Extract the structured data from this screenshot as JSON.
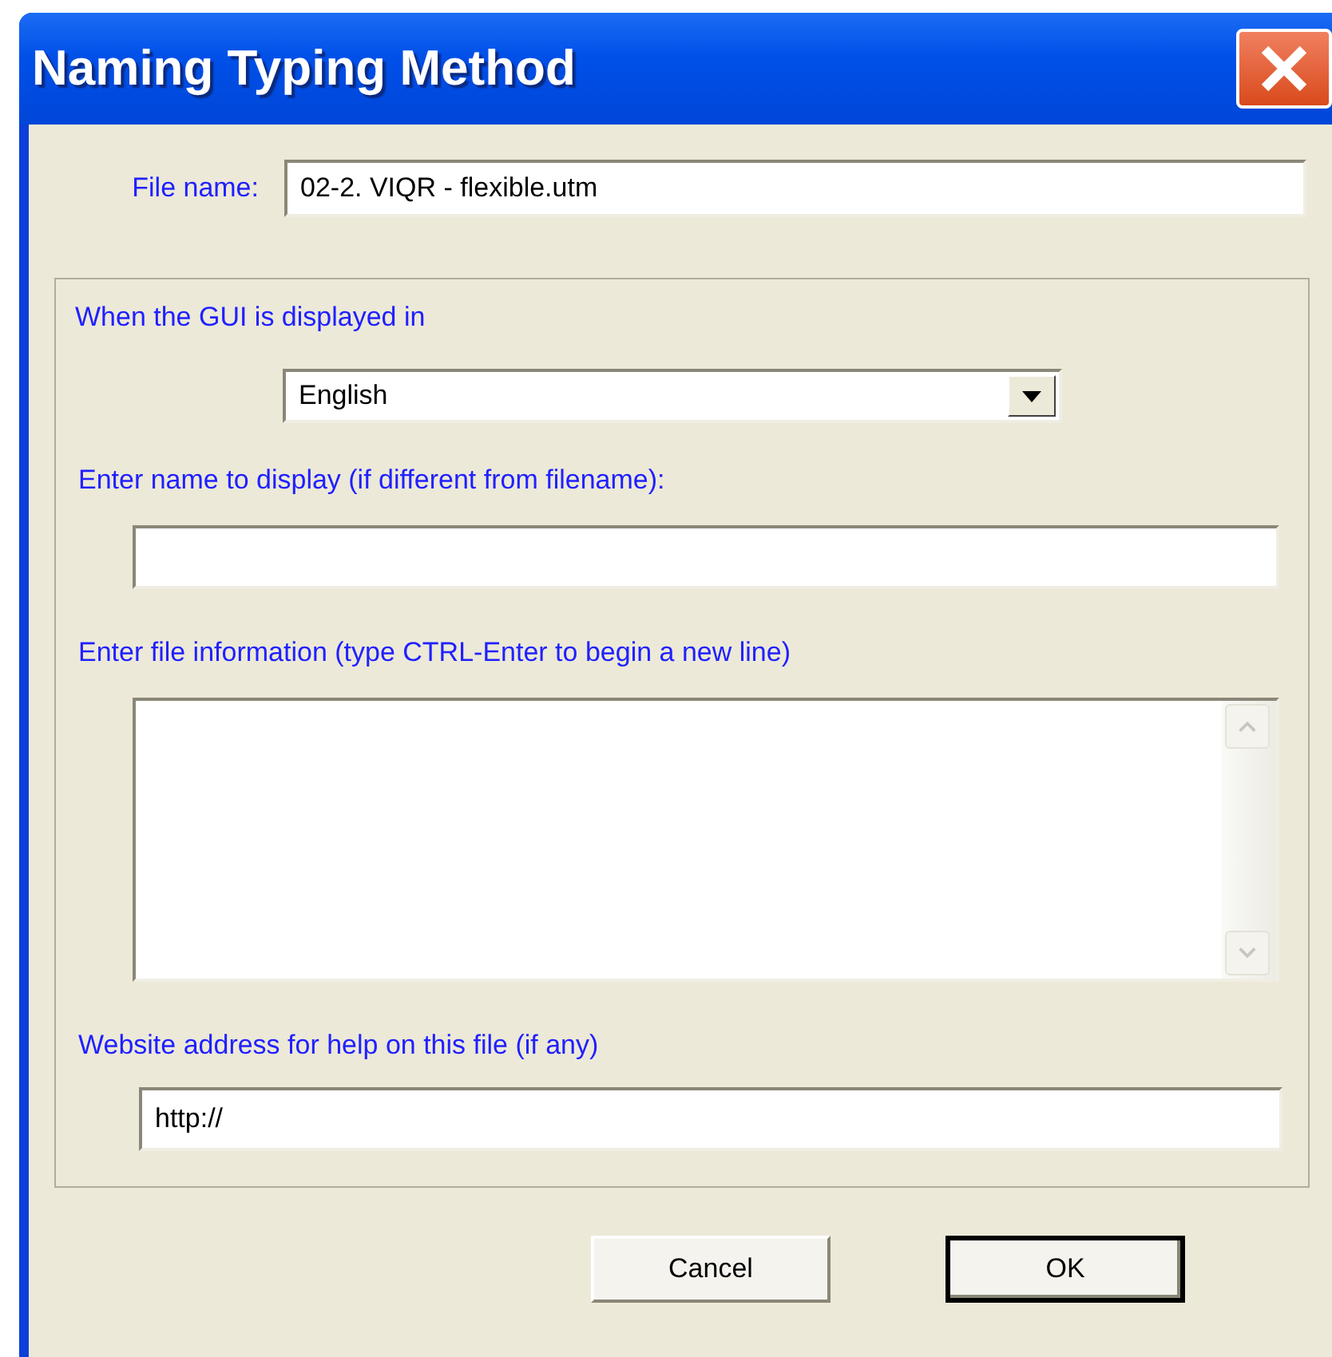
{
  "window": {
    "title": "Naming Typing Method"
  },
  "file_name": {
    "label": "File name:",
    "value": "02-2. VIQR - flexible.utm"
  },
  "group": {
    "language_label": "When the GUI is displayed in",
    "language": {
      "value": "English"
    },
    "display_name": {
      "label": "Enter name to display (if different from filename):"
    },
    "file_info": {
      "label": "Enter file information (type CTRL-Enter to begin a new line)"
    },
    "website": {
      "label": "Website address for help on this file (if any)",
      "value": "http://"
    }
  },
  "buttons": [
    {
      "label": "Cancel",
      "default": false
    },
    {
      "label": "OK",
      "default": true
    }
  ]
}
